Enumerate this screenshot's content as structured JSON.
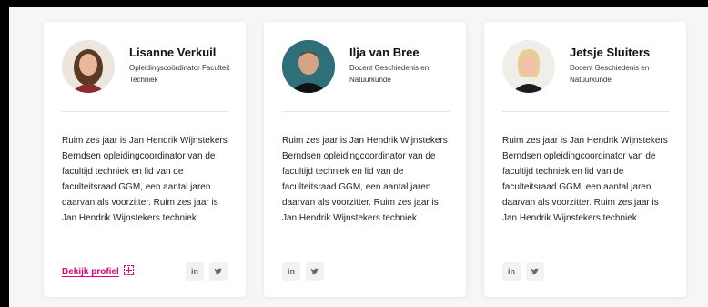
{
  "cards": [
    {
      "name": "Lisanne Verkuil",
      "role": "Opleidingscoördinator Faculteit Techniek",
      "bio": "Ruim zes jaar is Jan Hendrik Wijnstekers Berndsen opleidingcoordinator van de facultijd techniek en lid van de faculteitsraad GGM, een aantal jaren daarvan als voorzitter. Ruim zes jaar is Jan Hendrik Wijnstekers techniek",
      "profile_link": "Bekijk profiel",
      "social": [
        "linkedin-icon",
        "twitter-icon"
      ]
    },
    {
      "name": "Ilja van Bree",
      "role": "Docent Geschiedenis en Natuurkunde",
      "bio": "Ruim zes jaar is Jan Hendrik Wijnstekers Berndsen opleidingcoordinator van de facultijd techniek en lid van de faculteitsraad GGM, een aantal jaren daarvan als voorzitter. Ruim zes jaar is Jan Hendrik Wijnstekers techniek",
      "social": [
        "linkedin-icon",
        "twitter-icon"
      ]
    },
    {
      "name": "Jetsje Sluiters",
      "role": "Docent Geschiedenis en Natuurkunde",
      "bio": "Ruim zes jaar is Jan Hendrik Wijnstekers Berndsen opleidingcoordinator van de facultijd techniek en lid van de faculteitsraad GGM, een aantal jaren daarvan als voorzitter. Ruim zes jaar is Jan Hendrik Wijnstekers techniek",
      "social": [
        "linkedin-icon",
        "twitter-icon"
      ]
    }
  ],
  "colors": {
    "accent": "#e2007a",
    "card_bg": "#ffffff",
    "page_bg": "#f6f6f6"
  }
}
